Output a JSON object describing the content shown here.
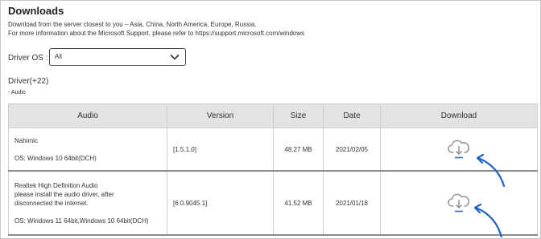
{
  "header": {
    "title": "Downloads",
    "desc_line1": "Download from the server closest to you – Asia, China, North America, Europe, Russia.",
    "desc_line2": "For more information about the Microsoft Support, please refer to https://support.microsoft.com/windows"
  },
  "filter": {
    "label": "Driver OS :",
    "selected": "All",
    "icon": "chevron-down-icon"
  },
  "drivers": {
    "count_label": "Driver(+22)",
    "category": "- Audio"
  },
  "table": {
    "headers": [
      "Audio",
      "Version",
      "Size",
      "Date",
      "Download"
    ],
    "rows": [
      {
        "name_lines": [
          "Nahimic"
        ],
        "os": "OS: Windows 10 64bit(DCH)",
        "version": "[1.5.1.0]",
        "size": "48.27 MB",
        "date": "2021/02/05",
        "download_icon": "cloud-download-icon"
      },
      {
        "name_lines": [
          "Realtek High Definition Audio",
          "please install the audio driver, after",
          "disconnected the internet."
        ],
        "os": "OS: Windows 11 64bit,Windows 10 64bit(DCH)",
        "version": "[6.0.9045.1]",
        "size": "41.52 MB",
        "date": "2021/01/18",
        "download_icon": "cloud-download-icon"
      }
    ]
  },
  "colors": {
    "header_bg": "#e3e3e3",
    "annotation_arrow": "#1f63c6",
    "icon_gray": "#9a9a9a"
  }
}
